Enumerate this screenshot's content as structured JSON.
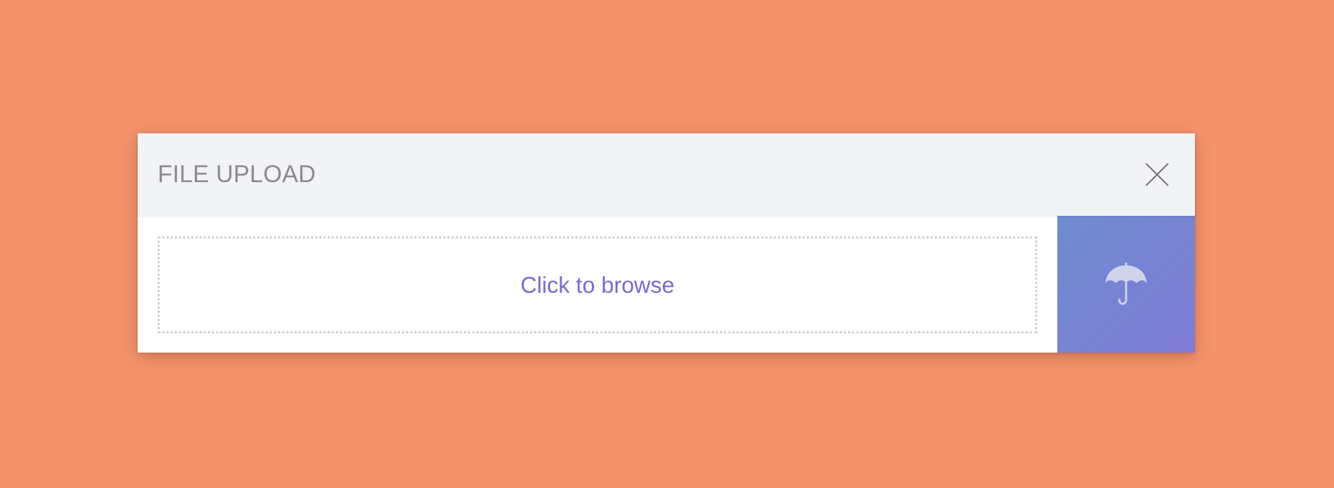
{
  "modal": {
    "title": "FILE UPLOAD",
    "close_icon": "close-icon",
    "drop_zone": {
      "label": "Click to browse"
    },
    "action_button": {
      "icon": "umbrella-icon"
    }
  },
  "colors": {
    "page_background": "#f4946d",
    "header_background": "#f1f3f7",
    "title_text": "#8c8c8f",
    "link_text": "#7a6ad1",
    "button_gradient_start": "#6f8ccf",
    "button_gradient_end": "#7f7bd6",
    "icon_color": "#cfd3ec"
  }
}
